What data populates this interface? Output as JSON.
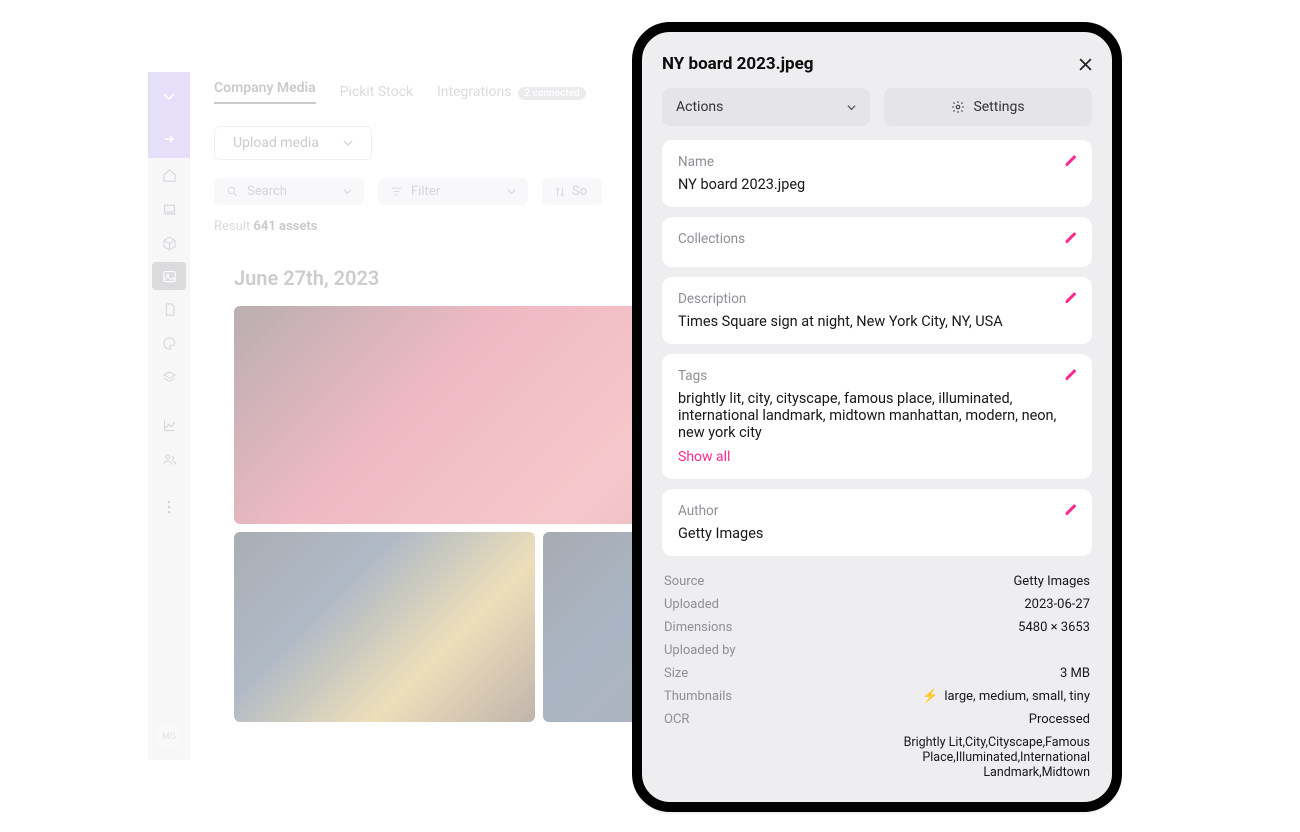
{
  "sidebar": {
    "avatar_initials": "MG"
  },
  "tabs": {
    "company_media": "Company Media",
    "pickit_stock": "Pickit Stock",
    "integrations": "Integrations",
    "integrations_badge": "2 connected"
  },
  "toolbar": {
    "upload_label": "Upload media",
    "search_placeholder": "Search",
    "filter_label": "Filter",
    "sort_prefix": "So"
  },
  "results": {
    "prefix": "Result ",
    "count": "641 assets"
  },
  "group": {
    "date_heading": "June 27th, 2023"
  },
  "panel": {
    "title": "NY board 2023.jpeg",
    "actions_label": "Actions",
    "settings_label": "Settings",
    "name_label": "Name",
    "name_value": "NY board 2023.jpeg",
    "collections_label": "Collections",
    "description_label": "Description",
    "description_value": "Times Square sign at night, New York City, NY, USA",
    "tags_label": "Tags",
    "tags_value": "brightly lit, city, cityscape, famous place, illuminated, international landmark, midtown manhattan, modern, neon, new york city",
    "show_all": "Show all",
    "author_label": "Author",
    "author_value": "Getty Images"
  },
  "meta": {
    "source_k": "Source",
    "source_v": "Getty Images",
    "uploaded_k": "Uploaded",
    "uploaded_v": "2023-06-27",
    "dimensions_k": "Dimensions",
    "dimensions_v": "5480 × 3653",
    "uploadedby_k": "Uploaded by",
    "uploadedby_v": "",
    "size_k": "Size",
    "size_v": "3 MB",
    "thumbs_k": "Thumbnails",
    "thumbs_v": "large, medium, small, tiny",
    "ocr_k": "OCR",
    "ocr_v": "Processed",
    "ocr_detail": "Brightly Lit,City,Cityscape,Famous Place,Illuminated,International Landmark,Midtown"
  }
}
